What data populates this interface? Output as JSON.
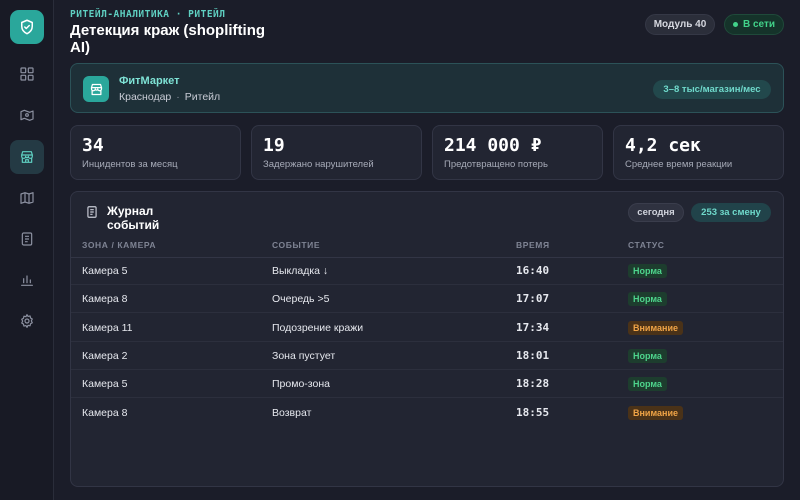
{
  "sidebar": {
    "logo_icon": "shield-check-icon",
    "items": [
      {
        "icon": "dashboard-grid-icon",
        "active": false
      },
      {
        "icon": "map-route-icon",
        "active": false
      },
      {
        "icon": "store-icon",
        "active": true
      },
      {
        "icon": "map-icon",
        "active": false
      },
      {
        "icon": "document-icon",
        "active": false
      },
      {
        "icon": "bar-chart-icon",
        "active": false
      },
      {
        "icon": "gear-icon",
        "active": false
      }
    ]
  },
  "header": {
    "kicker": "РИТЕЙЛ-АНАЛИТИКА · РИТЕЙЛ",
    "title": "Детекция краж (shoplifting AI)",
    "module_label": "Модуль 40",
    "online_label": "В сети"
  },
  "store": {
    "name": "ФитМаркет",
    "city": "Краснодар",
    "segment": "Ритейл",
    "badge": "3–8 тыс/магазин/мес"
  },
  "stats": [
    {
      "value": "34",
      "label": "Инцидентов за месяц"
    },
    {
      "value": "19",
      "label": "Задержано нарушителей"
    },
    {
      "value": "214 000 ₽",
      "label": "Предотвращено потерь"
    },
    {
      "value": "4,2 сек",
      "label": "Среднее время реакции"
    }
  ],
  "journal": {
    "title": "Журнал событий",
    "today_label": "сегодня",
    "shift_label": "253 за смену",
    "columns": {
      "zone": "ЗОНА / КАМЕРА",
      "event": "СОБЫТИЕ",
      "time": "ВРЕМЯ",
      "status": "СТАТУС"
    },
    "rows": [
      {
        "zone": "Камера 5",
        "event": "Выкладка ↓",
        "time": "16:40",
        "status": "Норма",
        "level": "ok"
      },
      {
        "zone": "Камера 8",
        "event": "Очередь >5",
        "time": "17:07",
        "status": "Норма",
        "level": "ok"
      },
      {
        "zone": "Камера 11",
        "event": "Подозрение кражи",
        "time": "17:34",
        "status": "Внимание",
        "level": "warn"
      },
      {
        "zone": "Камера 2",
        "event": "Зона пустует",
        "time": "18:01",
        "status": "Норма",
        "level": "ok"
      },
      {
        "zone": "Камера 5",
        "event": "Промо-зона",
        "time": "18:28",
        "status": "Норма",
        "level": "ok"
      },
      {
        "zone": "Камера 8",
        "event": "Возврат",
        "time": "18:55",
        "status": "Внимание",
        "level": "warn"
      }
    ]
  },
  "colors": {
    "accent": "#2aa79b",
    "ok": "#4ed48c",
    "warn": "#f0a446",
    "background": "#1b1d29"
  }
}
